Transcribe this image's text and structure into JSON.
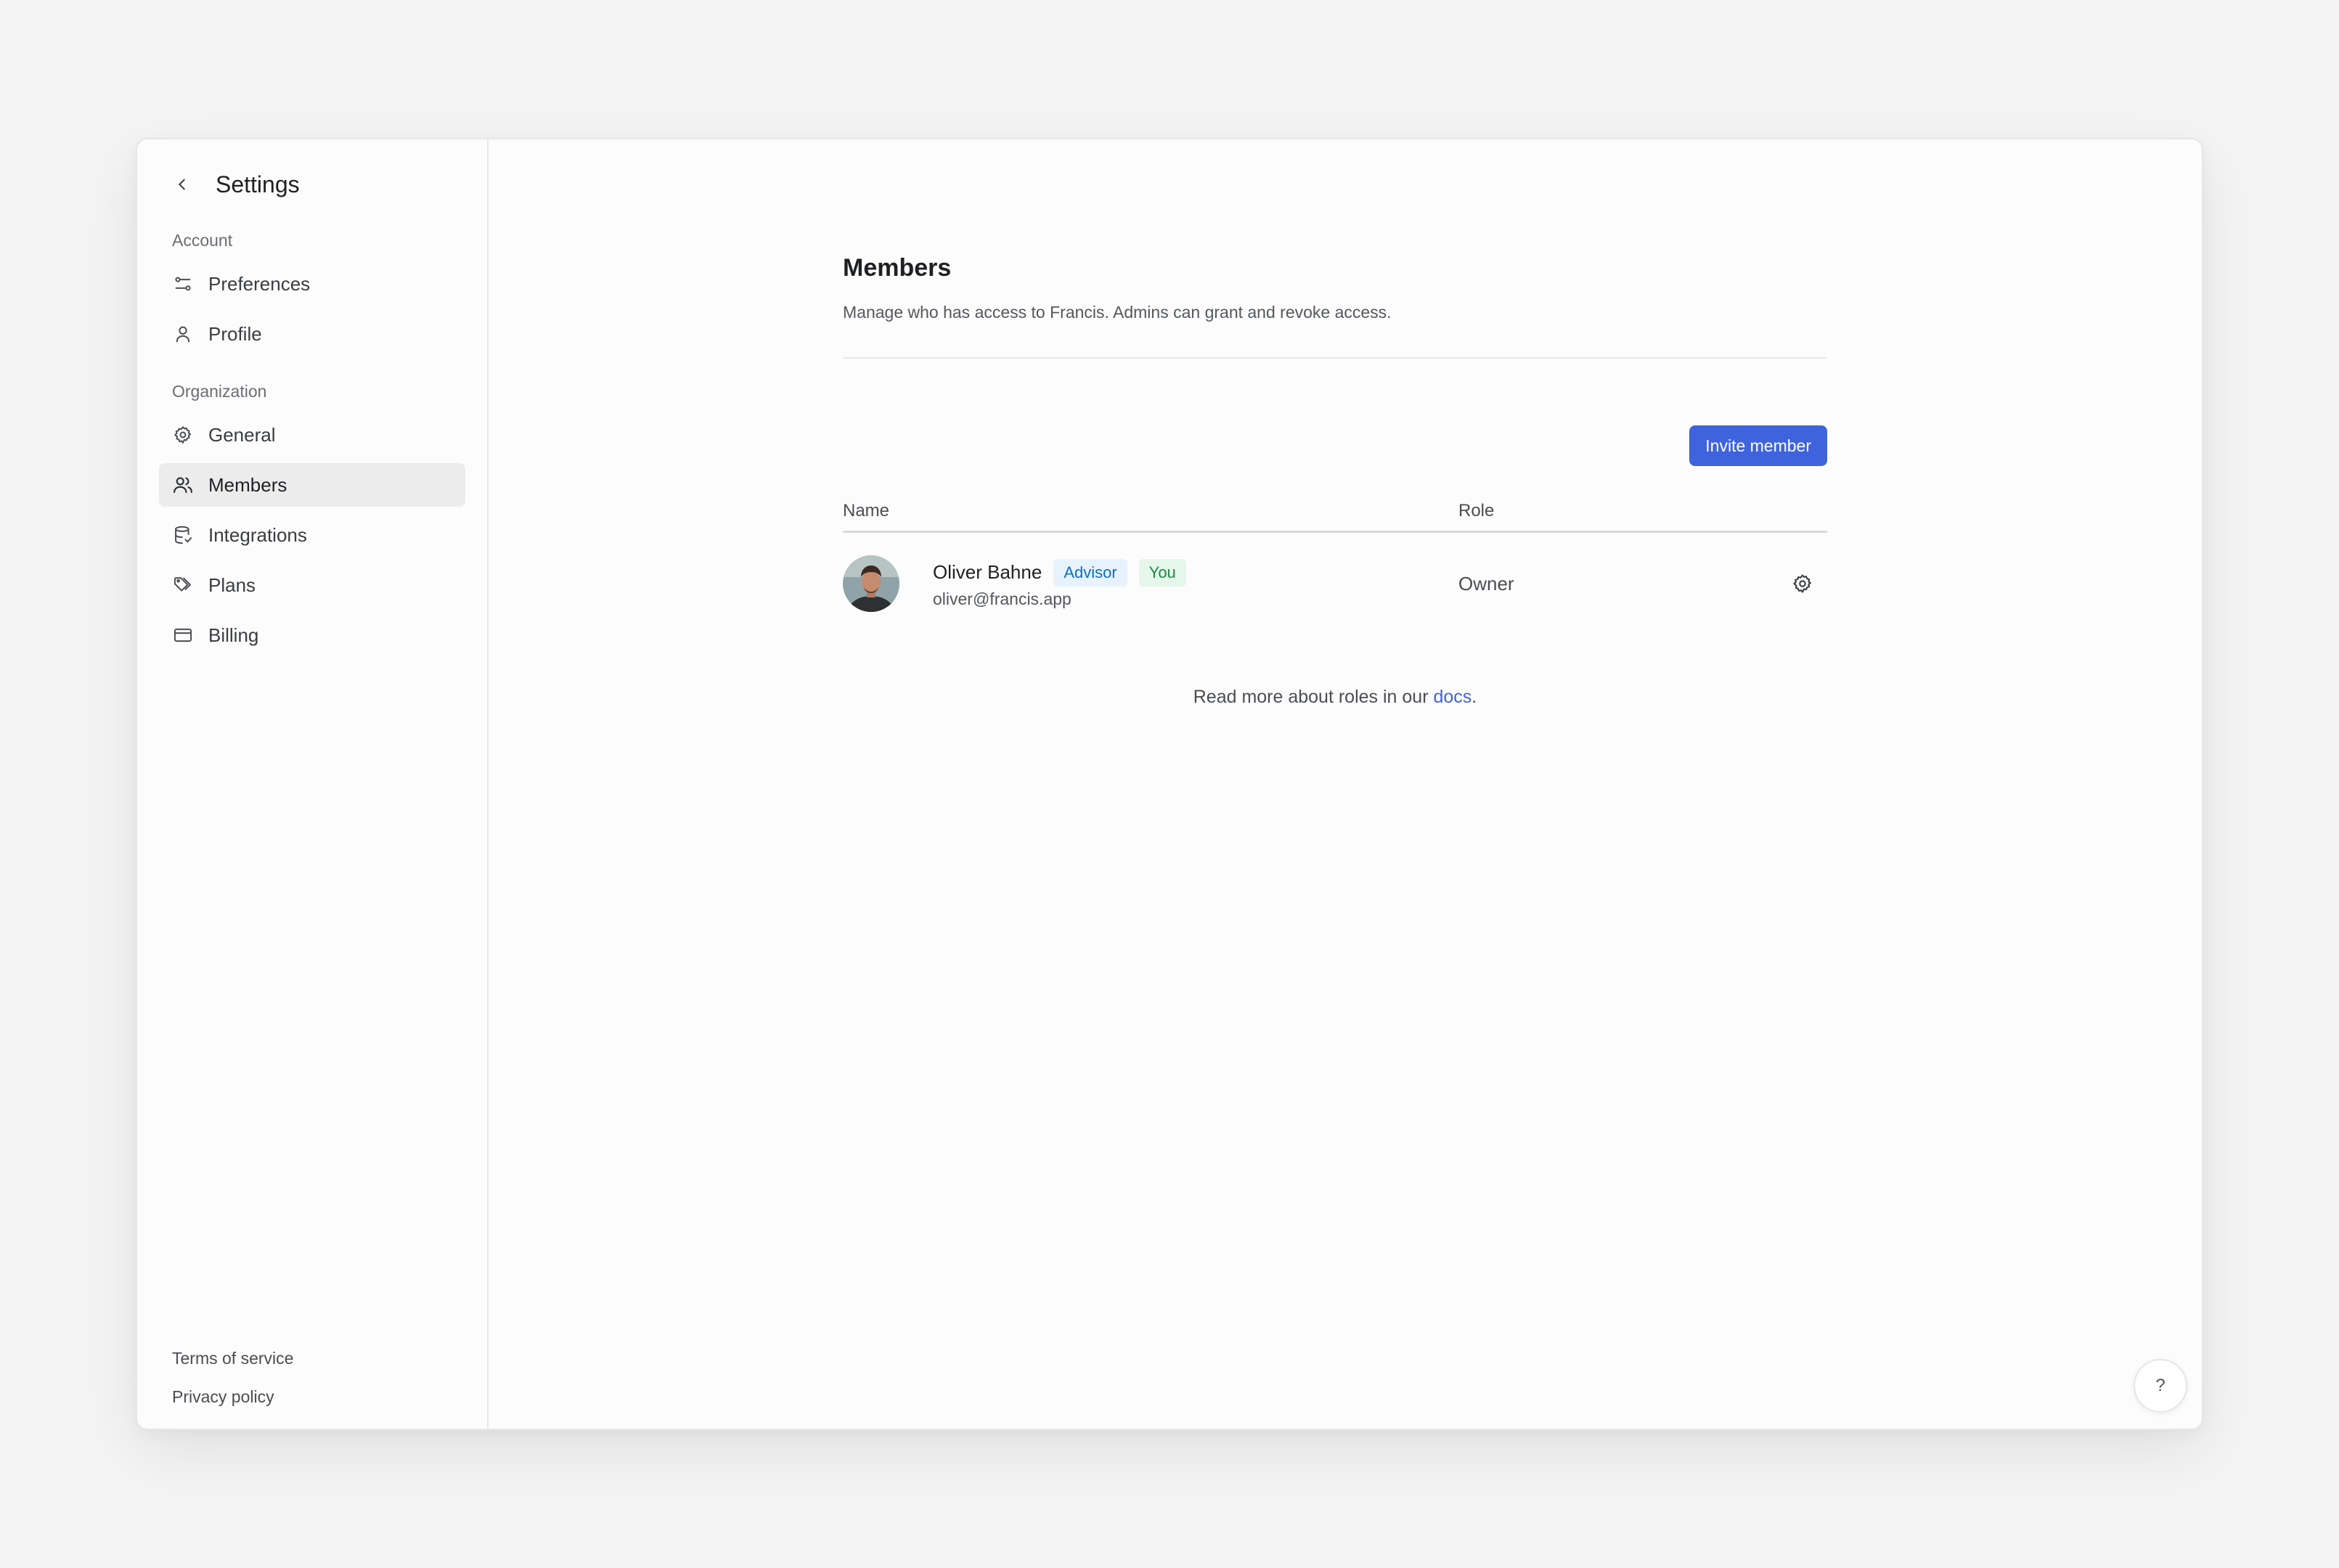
{
  "sidebar": {
    "title": "Settings",
    "back_icon": "chevron-left-icon",
    "account_label": "Account",
    "account_items": [
      {
        "label": "Preferences",
        "icon": "sliders-icon"
      },
      {
        "label": "Profile",
        "icon": "user-icon"
      }
    ],
    "organization_label": "Organization",
    "org_items": [
      {
        "label": "General",
        "icon": "gear-icon"
      },
      {
        "label": "Members",
        "icon": "users-icon",
        "active": true
      },
      {
        "label": "Integrations",
        "icon": "database-icon"
      },
      {
        "label": "Plans",
        "icon": "tags-icon"
      },
      {
        "label": "Billing",
        "icon": "credit-card-icon"
      }
    ],
    "footer": {
      "terms": "Terms of service",
      "privacy": "Privacy policy"
    }
  },
  "main": {
    "title": "Members",
    "description": "Manage who has access to Francis. Admins can grant and revoke access.",
    "invite_button": "Invite member",
    "table": {
      "columns": [
        "Name",
        "Role"
      ],
      "rows": [
        {
          "name": "Oliver Bahne",
          "email": "oliver@francis.app",
          "badges": [
            "Advisor",
            "You"
          ],
          "role": "Owner",
          "action_icon": "gear-icon"
        }
      ]
    },
    "footnote_text": "Read more about roles in our ",
    "footnote_link": "docs",
    "footnote_end": "."
  },
  "help_button": "?",
  "colors": {
    "accent": "#3e63dd",
    "advisor_badge_bg": "#e6f3fd",
    "advisor_badge_fg": "#0b6fc2",
    "you_badge_bg": "#e4f7ea",
    "you_badge_fg": "#1d8a43",
    "active_nav_bg": "#ececec"
  }
}
